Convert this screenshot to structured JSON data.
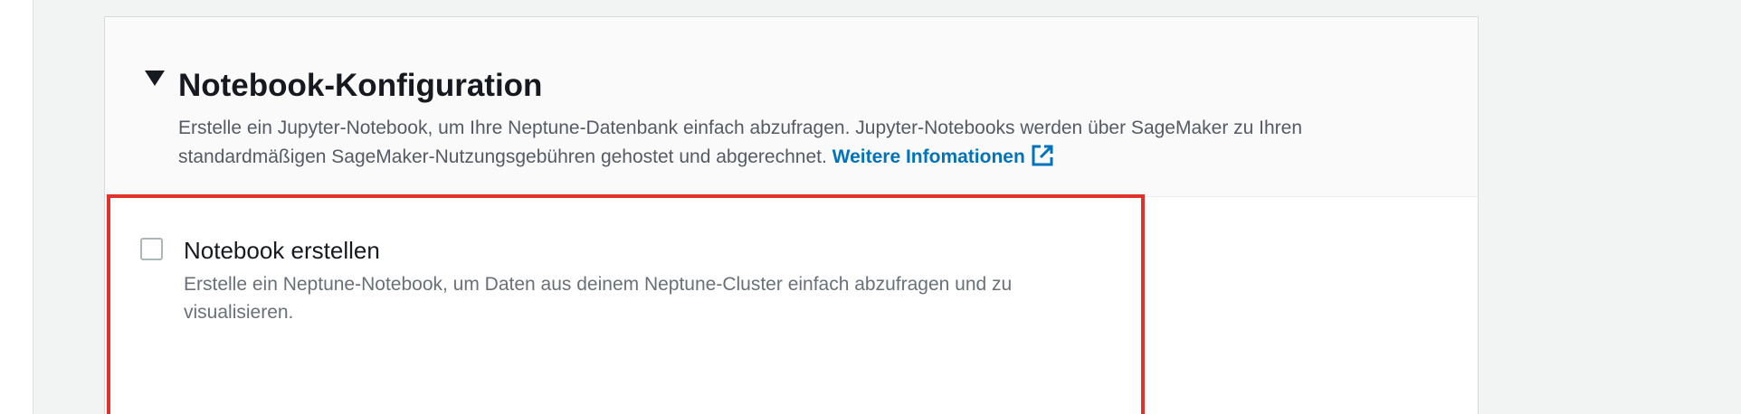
{
  "notebook_section": {
    "title": "Notebook-Konfiguration",
    "toggle_icon": "caret-down-icon",
    "description": "Erstelle ein Jupyter-Notebook, um Ihre Neptune-Datenbank einfach abzufragen. Jupyter-Notebooks werden über SageMaker zu Ihren standardmäßigen SageMaker-Nutzungsgebühren gehostet und abgerechnet.",
    "learn_more_label": "Weitere Infomationen",
    "learn_more_icon": "external-link-icon"
  },
  "create_notebook": {
    "label": "Notebook erstellen",
    "description": "Erstelle ein Neptune-Notebook, um Daten aus deinem Neptune-Cluster einfach abzufragen und zu visualisieren.",
    "checked": false
  },
  "colors": {
    "link": "#0073bb",
    "highlight_border": "#e2312b",
    "background": "#f2f3f3"
  }
}
